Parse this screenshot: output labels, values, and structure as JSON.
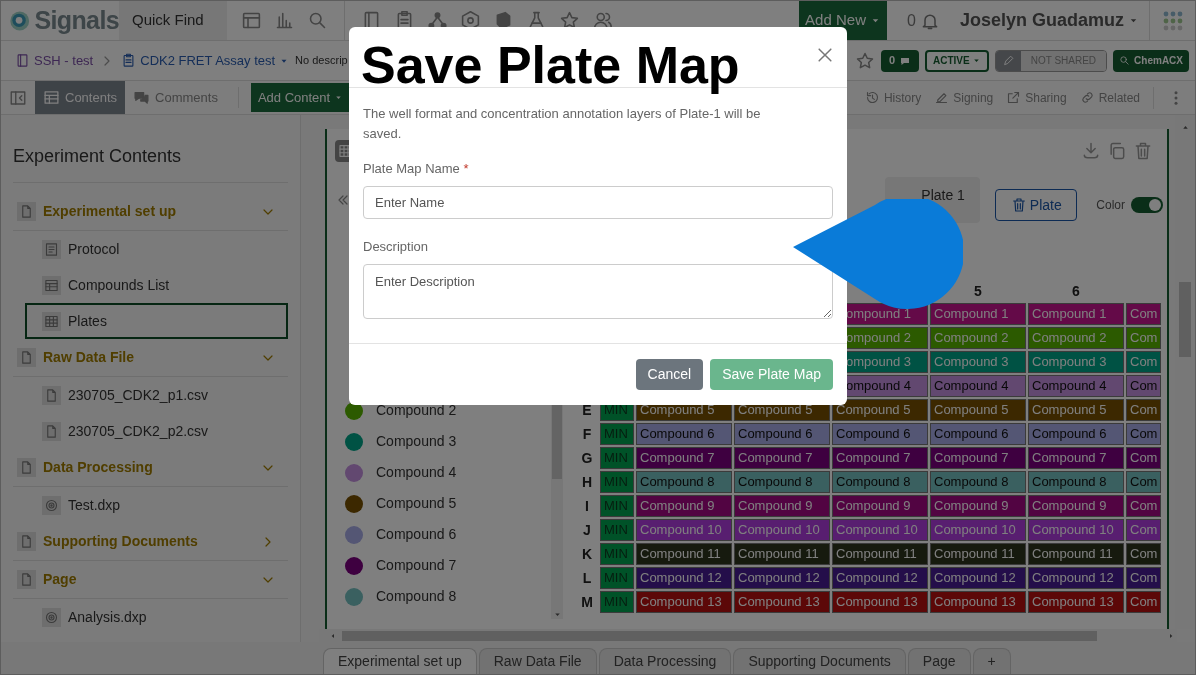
{
  "app_bar": {
    "logo": "Signals",
    "quick_find": "Quick Find",
    "add_new": "Add New",
    "notifications": "0",
    "user": "Joselyn Guadamuz"
  },
  "breadcrumb": {
    "notebook": "SSH - test",
    "experiment": "CDK2 FRET Assay test",
    "description": "No descrip"
  },
  "status": {
    "comments": "0",
    "state": "ACTIVE",
    "sharing": "NOT SHARED",
    "search": "ChemACX"
  },
  "toolbar": {
    "tabs": [
      {
        "label": "Contents",
        "selected": true
      },
      {
        "label": "Comments",
        "selected": false
      }
    ],
    "add_content": "Add Content",
    "actions": [
      {
        "label": "History",
        "kind": "history"
      },
      {
        "label": "Signing",
        "kind": "signing"
      },
      {
        "label": "Sharing",
        "kind": "sharing"
      },
      {
        "label": "Related",
        "kind": "related"
      }
    ]
  },
  "sidebar": {
    "title": "Experiment Contents",
    "sections": [
      {
        "label": "Experimental set up",
        "expanded": true,
        "children": [
          {
            "label": "Protocol",
            "kind": "text",
            "selected": false
          },
          {
            "label": "Compounds List",
            "kind": "table",
            "selected": false
          },
          {
            "label": "Plates",
            "kind": "plate",
            "selected": true
          }
        ]
      },
      {
        "label": "Raw Data File",
        "expanded": true,
        "children": [
          {
            "label": "230705_CDK2_p1.csv",
            "kind": "file",
            "selected": false
          },
          {
            "label": "230705_CDK2_p2.csv",
            "kind": "file",
            "selected": false
          }
        ]
      },
      {
        "label": "Data Processing",
        "expanded": true,
        "children": [
          {
            "label": "Test.dxp",
            "kind": "analysis",
            "selected": false
          }
        ]
      },
      {
        "label": "Supporting Documents",
        "expanded": false
      },
      {
        "label": "Page",
        "expanded": true,
        "children": [
          {
            "label": "Analysis.dxp",
            "kind": "analysis",
            "selected": false
          }
        ]
      }
    ]
  },
  "plate_panel": {
    "plate_name": "Plate 1",
    "delete_button": "Plate",
    "color_toggle": {
      "label": "Color",
      "on": true
    },
    "legend": [
      {
        "label": "Compound 2",
        "color": "#2c5a00"
      },
      {
        "label": "Compound 3",
        "color": "#005244"
      },
      {
        "label": "Compound 4",
        "color": "#624870"
      },
      {
        "label": "Compound 5",
        "color": "#3c2800"
      },
      {
        "label": "Compound 6",
        "color": "#545674"
      },
      {
        "label": "Compound 7",
        "color": "#3e0040"
      },
      {
        "label": "Compound 8",
        "color": "#3a6060"
      }
    ],
    "column_headers": [
      "5",
      "6"
    ],
    "rows": [
      {
        "cells": [
          "ompound 1",
          "Compound 1",
          "Compound 1",
          "Com"
        ],
        "color": "#640a48"
      },
      {
        "cells": [
          "ompound 2",
          "Compound 2",
          "Compound 2",
          "Com"
        ],
        "color": "#2c5a00"
      },
      {
        "cells": [
          "ompound 3",
          "Compound 3",
          "Compound 3",
          "Com"
        ],
        "color": "#005244"
      },
      {
        "cells": [
          "ompound 4",
          "Compound 4",
          "Compound 4",
          "Com"
        ],
        "color": "#624870"
      },
      {
        "label": "E",
        "min": {
          "text": "MIN",
          "color": "#005228"
        },
        "cells": [
          "Compound 5",
          "Compound 5",
          "Compound 5",
          "Compound 5",
          "Compound 5",
          "Com"
        ],
        "color": "#3c2800"
      },
      {
        "label": "F",
        "min": {
          "text": "MIN",
          "color": "#005228"
        },
        "cells": [
          "Compound 6",
          "Compound 6",
          "Compound 6",
          "Compound 6",
          "Compound 6",
          "Com"
        ],
        "color": "#545674"
      },
      {
        "label": "G",
        "min": {
          "text": "MIN",
          "color": "#005228"
        },
        "cells": [
          "Compound 7",
          "Compound 7",
          "Compound 7",
          "Compound 7",
          "Compound 7",
          "Com"
        ],
        "color": "#3e0040"
      },
      {
        "label": "H",
        "min": {
          "text": "MIN",
          "color": "#005228"
        },
        "cells": [
          "Compound 8",
          "Compound 8",
          "Compound 8",
          "Compound 8",
          "Compound 8",
          "Com"
        ],
        "color": "#3a6060"
      },
      {
        "label": "I",
        "min": {
          "text": "MIN",
          "color": "#005228"
        },
        "cells": [
          "Compound 9",
          "Compound 9",
          "Compound 9",
          "Compound 9",
          "Compound 9",
          "Com"
        ],
        "color": "#520442"
      },
      {
        "label": "J",
        "min": {
          "text": "MIN",
          "color": "#005228"
        },
        "cells": [
          "Compound 10",
          "Compound 10",
          "Compound 10",
          "Compound 10",
          "Compound 10",
          "Com"
        ],
        "color": "#581e70"
      },
      {
        "label": "K",
        "min": {
          "text": "MIN",
          "color": "#005228"
        },
        "cells": [
          "Compound 11",
          "Compound 11",
          "Compound 11",
          "Compound 11",
          "Compound 11",
          "Com"
        ],
        "color": "#161a0e"
      },
      {
        "label": "L",
        "min": {
          "text": "MIN",
          "color": "#005228"
        },
        "cells": [
          "Compound 12",
          "Compound 12",
          "Compound 12",
          "Compound 12",
          "Compound 12",
          "Com"
        ],
        "color": "#240e4a"
      },
      {
        "label": "M",
        "min": {
          "text": "MIN",
          "color": "#005228"
        },
        "cells": [
          "Compound 13",
          "Compound 13",
          "Compound 13",
          "Compound 13",
          "Compound 13",
          "Com"
        ],
        "color": "#5c0808"
      }
    ]
  },
  "bottom_tabs": [
    {
      "label": "Experimental set up",
      "selected": true
    },
    {
      "label": "Raw Data File",
      "selected": false
    },
    {
      "label": "Data Processing",
      "selected": false
    },
    {
      "label": "Supporting Documents",
      "selected": false
    },
    {
      "label": "Page",
      "selected": false
    },
    {
      "label": "+",
      "selected": false
    }
  ],
  "dialog": {
    "title": "Save Plate Map",
    "message": "The well format and concentration annotation layers of Plate-1 will be saved.",
    "name_label": "Plate Map Name",
    "required_mark": "*",
    "name_placeholder": "Enter Name",
    "description_label": "Description",
    "description_placeholder": "Enter Description",
    "cancel": "Cancel",
    "save": {
      "label": "Save Plate Map",
      "disabled": true
    }
  }
}
